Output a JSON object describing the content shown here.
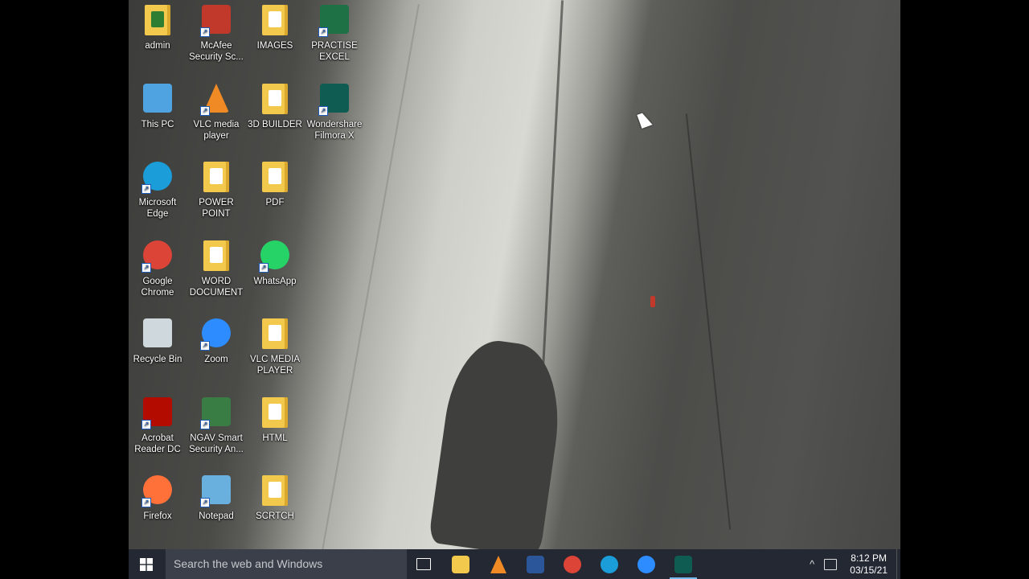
{
  "desktop_icons": [
    {
      "label_1": "admin",
      "label_2": "",
      "icon": "user-folder-icon",
      "color": "#f2c94c"
    },
    {
      "label_1": "McAfee",
      "label_2": "Security Sc...",
      "icon": "mcafee-shield-icon",
      "color": "#c0392b"
    },
    {
      "label_1": "IMAGES",
      "label_2": "",
      "icon": "folder-icon",
      "color": "#f2c94c"
    },
    {
      "label_1": "PRACTISE",
      "label_2": "EXCEL",
      "icon": "excel-file-icon",
      "color": "#1e7145"
    },
    {
      "label_1": "This PC",
      "label_2": "",
      "icon": "computer-icon",
      "color": "#4fa3e0"
    },
    {
      "label_1": "VLC media",
      "label_2": "player",
      "icon": "vlc-cone-icon",
      "color": "#f08a24"
    },
    {
      "label_1": "3D BUILDER",
      "label_2": "",
      "icon": "folder-icon",
      "color": "#f2c94c"
    },
    {
      "label_1": "Wondershare",
      "label_2": "Filmora X",
      "icon": "filmora-icon",
      "color": "#0f5c52"
    },
    {
      "label_1": "Microsoft",
      "label_2": "Edge",
      "icon": "edge-icon",
      "color": "#1a9dd9"
    },
    {
      "label_1": "POWER",
      "label_2": "POINT",
      "icon": "folder-icon",
      "color": "#f2c94c"
    },
    {
      "label_1": "PDF",
      "label_2": "",
      "icon": "folder-icon",
      "color": "#f2c94c"
    },
    {
      "label_1": "Google",
      "label_2": "Chrome",
      "icon": "chrome-icon",
      "color": "#db4437"
    },
    {
      "label_1": "WORD",
      "label_2": "DOCUMENT",
      "icon": "folder-icon",
      "color": "#f2c94c"
    },
    {
      "label_1": "WhatsApp",
      "label_2": "",
      "icon": "whatsapp-icon",
      "color": "#25d366"
    },
    {
      "label_1": "Recycle Bin",
      "label_2": "",
      "icon": "recycle-bin-icon",
      "color": "#cfd8dc"
    },
    {
      "label_1": "Zoom",
      "label_2": "",
      "icon": "zoom-icon",
      "color": "#2d8cff"
    },
    {
      "label_1": "VLC MEDIA",
      "label_2": "PLAYER",
      "icon": "folder-icon",
      "color": "#f2c94c"
    },
    {
      "label_1": "Acrobat",
      "label_2": "Reader DC",
      "icon": "acrobat-icon",
      "color": "#b30b00"
    },
    {
      "label_1": "NGAV Smart",
      "label_2": "Security An...",
      "icon": "ngav-icon",
      "color": "#3a7d44"
    },
    {
      "label_1": "HTML",
      "label_2": "",
      "icon": "folder-icon",
      "color": "#f2c94c"
    },
    {
      "label_1": "Firefox",
      "label_2": "",
      "icon": "firefox-icon",
      "color": "#ff7139"
    },
    {
      "label_1": "Notepad",
      "label_2": "",
      "icon": "notepad-icon",
      "color": "#6ab0de"
    },
    {
      "label_1": "SCRTCH",
      "label_2": "",
      "icon": "folder-icon",
      "color": "#f2c94c"
    }
  ],
  "taskbar": {
    "search_placeholder": "Search the web and Windows",
    "pinned": [
      {
        "name": "task-view-icon",
        "color": "#ffffff"
      },
      {
        "name": "file-explorer-icon",
        "color": "#f2c94c"
      },
      {
        "name": "vlc-icon",
        "color": "#f08a24"
      },
      {
        "name": "word-icon",
        "color": "#2b579a"
      },
      {
        "name": "chrome-icon",
        "color": "#db4437"
      },
      {
        "name": "edge-icon",
        "color": "#1a9dd9"
      },
      {
        "name": "zoom-icon",
        "color": "#2d8cff"
      },
      {
        "name": "filmora-icon",
        "color": "#0f5c52"
      }
    ],
    "time": "8:12 PM",
    "date": "03/15/21"
  }
}
